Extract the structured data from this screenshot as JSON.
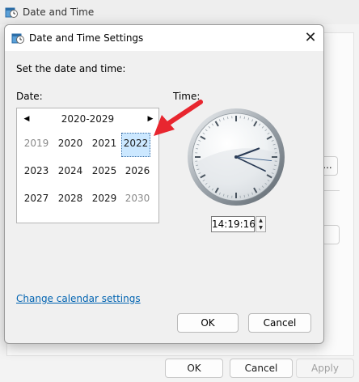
{
  "parent_window": {
    "title": "Date and Time",
    "footer": {
      "ok_label": "OK",
      "cancel_label": "Cancel",
      "apply_label": "Apply"
    },
    "partial_button_label": "..."
  },
  "dialog": {
    "title": "Date and Time Settings",
    "prompt": "Set the date and time:",
    "date_label": "Date:",
    "time_label": "Time:",
    "calendar": {
      "range_label": "2020-2029",
      "years": [
        "2019",
        "2020",
        "2021",
        "2022",
        "2023",
        "2024",
        "2025",
        "2026",
        "2027",
        "2028",
        "2029",
        "2030"
      ],
      "selected_year": "2022"
    },
    "clock": {
      "hour": 14,
      "minute": 19,
      "second": 16
    },
    "time_value": "14:19:16",
    "change_calendar_link": "Change calendar settings",
    "ok_label": "OK",
    "cancel_label": "Cancel"
  },
  "colors": {
    "accent_selected": "#cce8ff",
    "link": "#0063b1",
    "annotation_arrow": "#e8262f"
  }
}
